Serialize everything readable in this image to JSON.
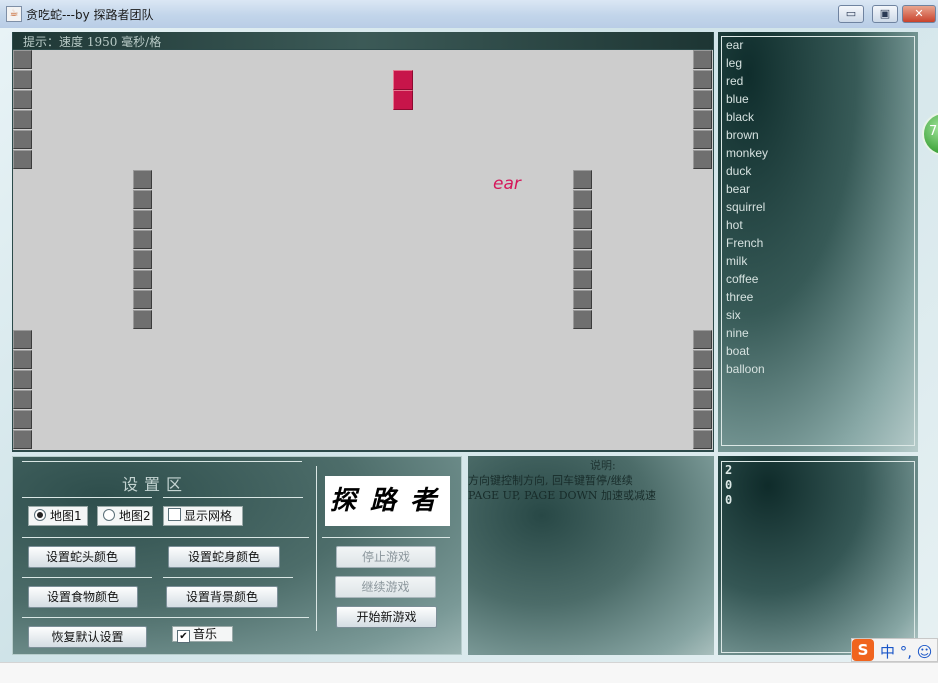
{
  "window": {
    "title": "贪吃蛇---by 探路者团队",
    "icon": "java-cup-icon",
    "minimize_glyph": "▭",
    "maximize_glyph": "▣",
    "close_glyph": "✕"
  },
  "hint": {
    "text": "提示：速度 1950 毫秒/格"
  },
  "board": {
    "food_word": "ear"
  },
  "word_list": [
    "ear",
    "leg",
    "red",
    "blue",
    "black",
    "brown",
    "monkey",
    "duck",
    "bear",
    "squirrel",
    "hot",
    "French",
    "milk",
    "coffee",
    "three",
    "six",
    "nine",
    "boat",
    "balloon"
  ],
  "settings": {
    "title": "设置区",
    "map1_label": "地图1",
    "map1_selected": true,
    "map2_label": "地图2",
    "map2_selected": false,
    "show_grid_label": "显示网格",
    "show_grid_checked": false,
    "snake_head_color_label": "设置蛇头颜色",
    "snake_body_color_label": "设置蛇身颜色",
    "food_color_label": "设置食物颜色",
    "background_color_label": "设置背景颜色",
    "restore_default_label": "恢复默认设置",
    "music_label": "音乐",
    "music_checked": true,
    "check_glyph": "✔"
  },
  "logo": {
    "text": "探路者"
  },
  "game_buttons": {
    "stop_label": "停止游戏",
    "continue_label": "继续游戏",
    "new_game_label": "开始新游戏"
  },
  "instructions": {
    "title": "说明:",
    "line1": "方向键控制方向, 回车键暂停/继续",
    "line2": "PAGE UP, PAGE DOWN 加速或减速"
  },
  "score": {
    "digits": [
      "2",
      "0",
      "0"
    ]
  },
  "overlays": {
    "green_badge_number": "7",
    "ime_logo": "S",
    "ime_text": "中 °, ☺"
  },
  "colors": {
    "snake": "#c7154a",
    "food_word": "#d5165a",
    "board_bg": "#cdcdcd",
    "wall": "#6f6f6f"
  }
}
